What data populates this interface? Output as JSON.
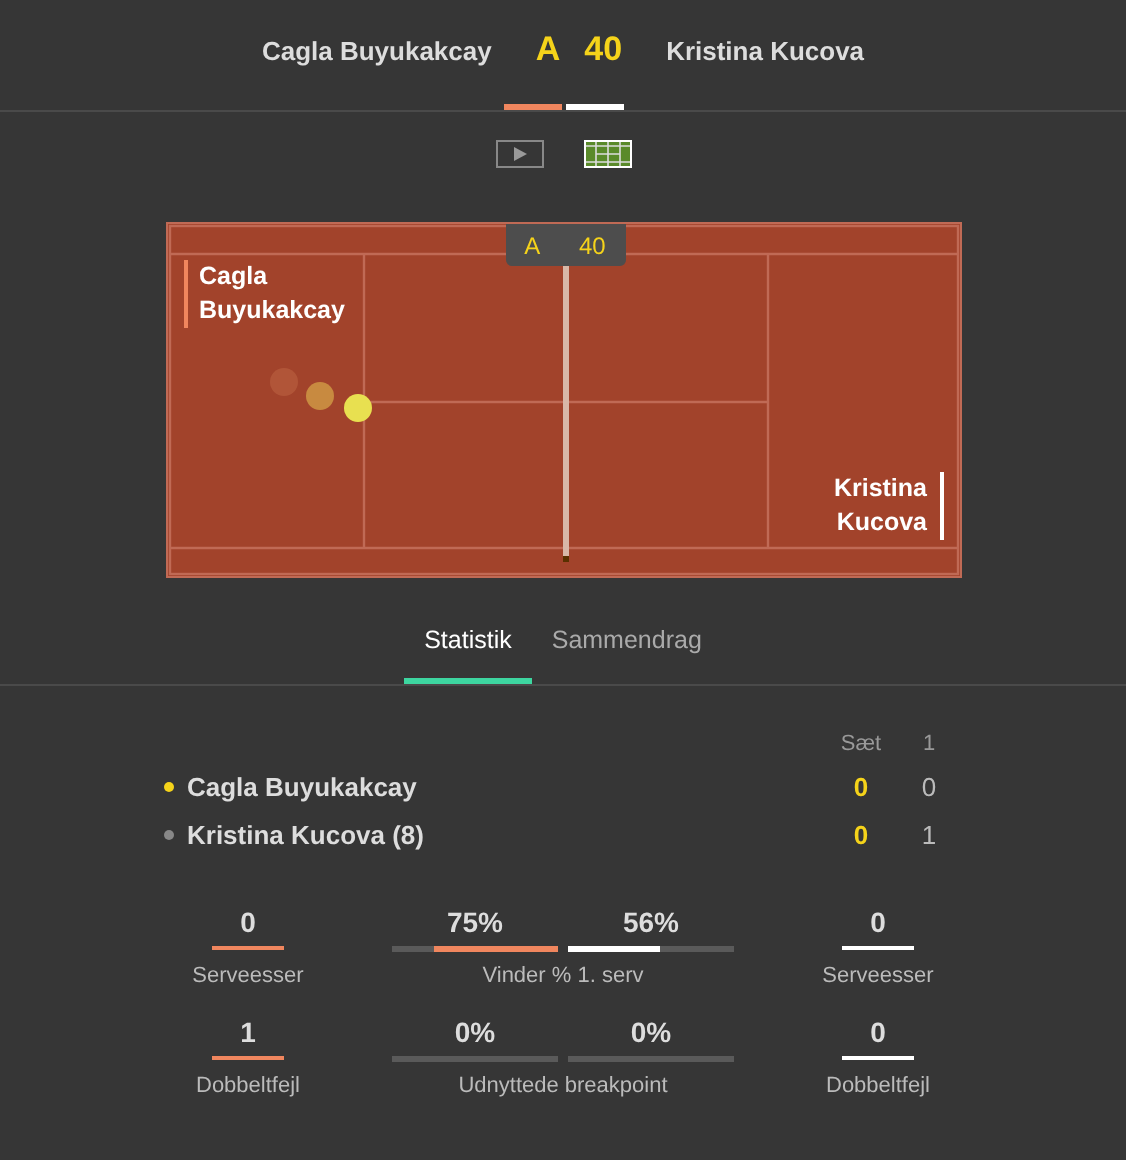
{
  "header": {
    "players": [
      {
        "name": "Cagla Buyukakcay",
        "color": "#f0865e"
      },
      {
        "name": "Kristina Kucova",
        "color": "#ffffff"
      }
    ],
    "scores": [
      "A",
      "40"
    ]
  },
  "views": [
    {
      "kind": "video",
      "selected": false
    },
    {
      "kind": "court",
      "selected": true
    }
  ],
  "court": {
    "score_tab": [
      "A",
      "40"
    ],
    "labels": [
      {
        "name": "Cagla\nBuyukakcay",
        "color": "#f0865e"
      },
      {
        "name": "Kristina\nKucova",
        "color": "#ffffff"
      }
    ]
  },
  "tabs": [
    {
      "label": "Statistik",
      "selected": true
    },
    {
      "label": "Sammendrag",
      "selected": false
    }
  ],
  "scoreboard": {
    "columns": [
      "Sæt",
      "1"
    ],
    "rows": [
      {
        "name": "Cagla Buyukakcay",
        "serving": true,
        "sets": "0",
        "set_1": "0"
      },
      {
        "name": "Kristina Kucova (8)",
        "serving": false,
        "sets": "0",
        "set_1": "1"
      }
    ]
  },
  "stats": [
    {
      "home": {
        "value": "0",
        "label": "Serveesser"
      },
      "middle": {
        "label": "Vinder % 1. serv",
        "home": {
          "value": "75%",
          "level": 0.75
        },
        "away": {
          "value": "56%",
          "level": 0.56
        }
      },
      "away": {
        "value": "0",
        "label": "Serveesser"
      }
    },
    {
      "home": {
        "value": "1",
        "label": "Dobbeltfejl"
      },
      "middle": {
        "label": "Udnyttede breakpoint",
        "home": {
          "value": "0%",
          "level": 0
        },
        "away": {
          "value": "0%",
          "level": 0
        }
      },
      "away": {
        "value": "0",
        "label": "Dobbeltfejl"
      }
    }
  ]
}
